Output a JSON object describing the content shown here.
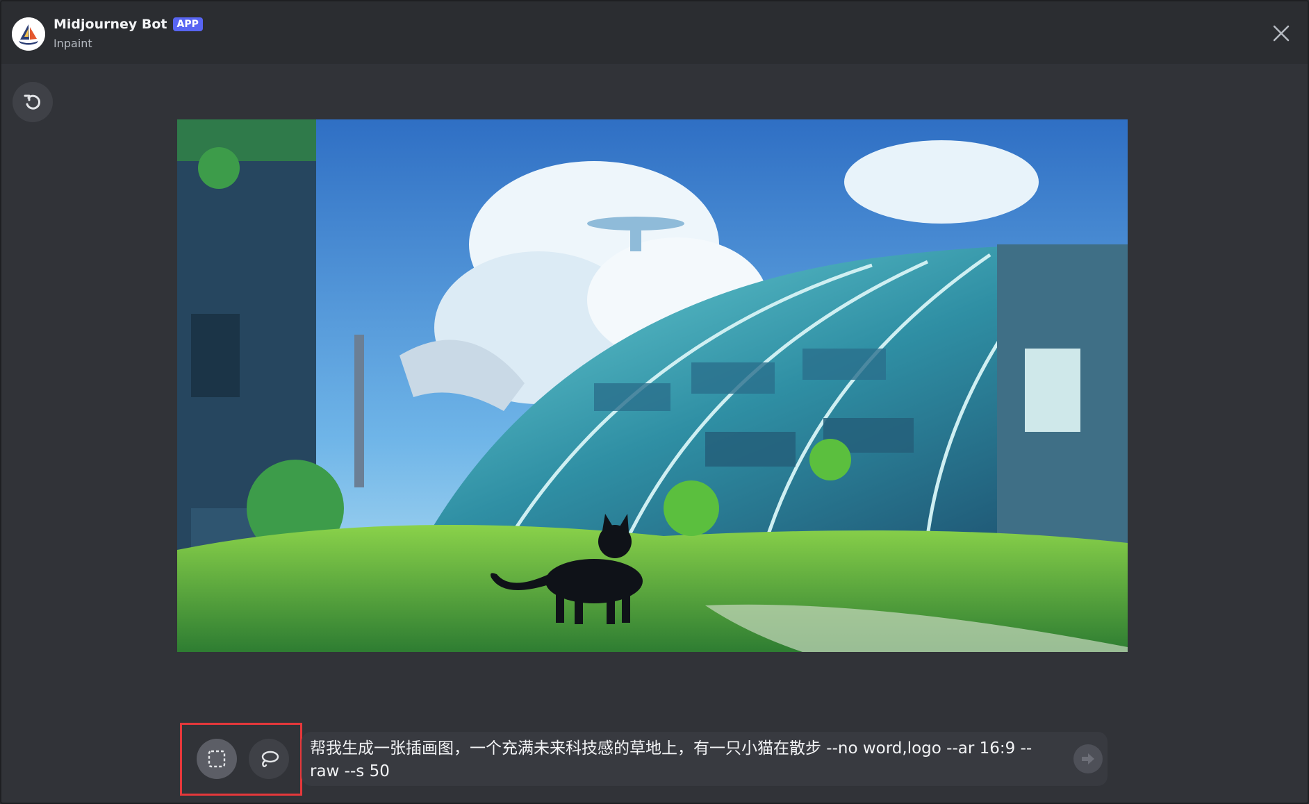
{
  "header": {
    "bot_name": "Midjourney Bot",
    "badge": "APP",
    "subtitle": "Inpaint",
    "close_icon": "close-icon"
  },
  "toolbar": {
    "undo_icon": "undo-icon",
    "rect_select_icon": "rectangle-select-icon",
    "lasso_icon": "lasso-select-icon",
    "send_icon": "send-arrow-icon"
  },
  "prompt": {
    "value": "帮我生成一张插画图，一个充满未来科技感的草地上，有一只小猫在散步 --no word,logo --ar 16:9 --raw --s 50"
  },
  "colors": {
    "accent": "#5865f2",
    "highlight": "#e5383b",
    "background": "#313338",
    "header": "#2b2d31"
  }
}
